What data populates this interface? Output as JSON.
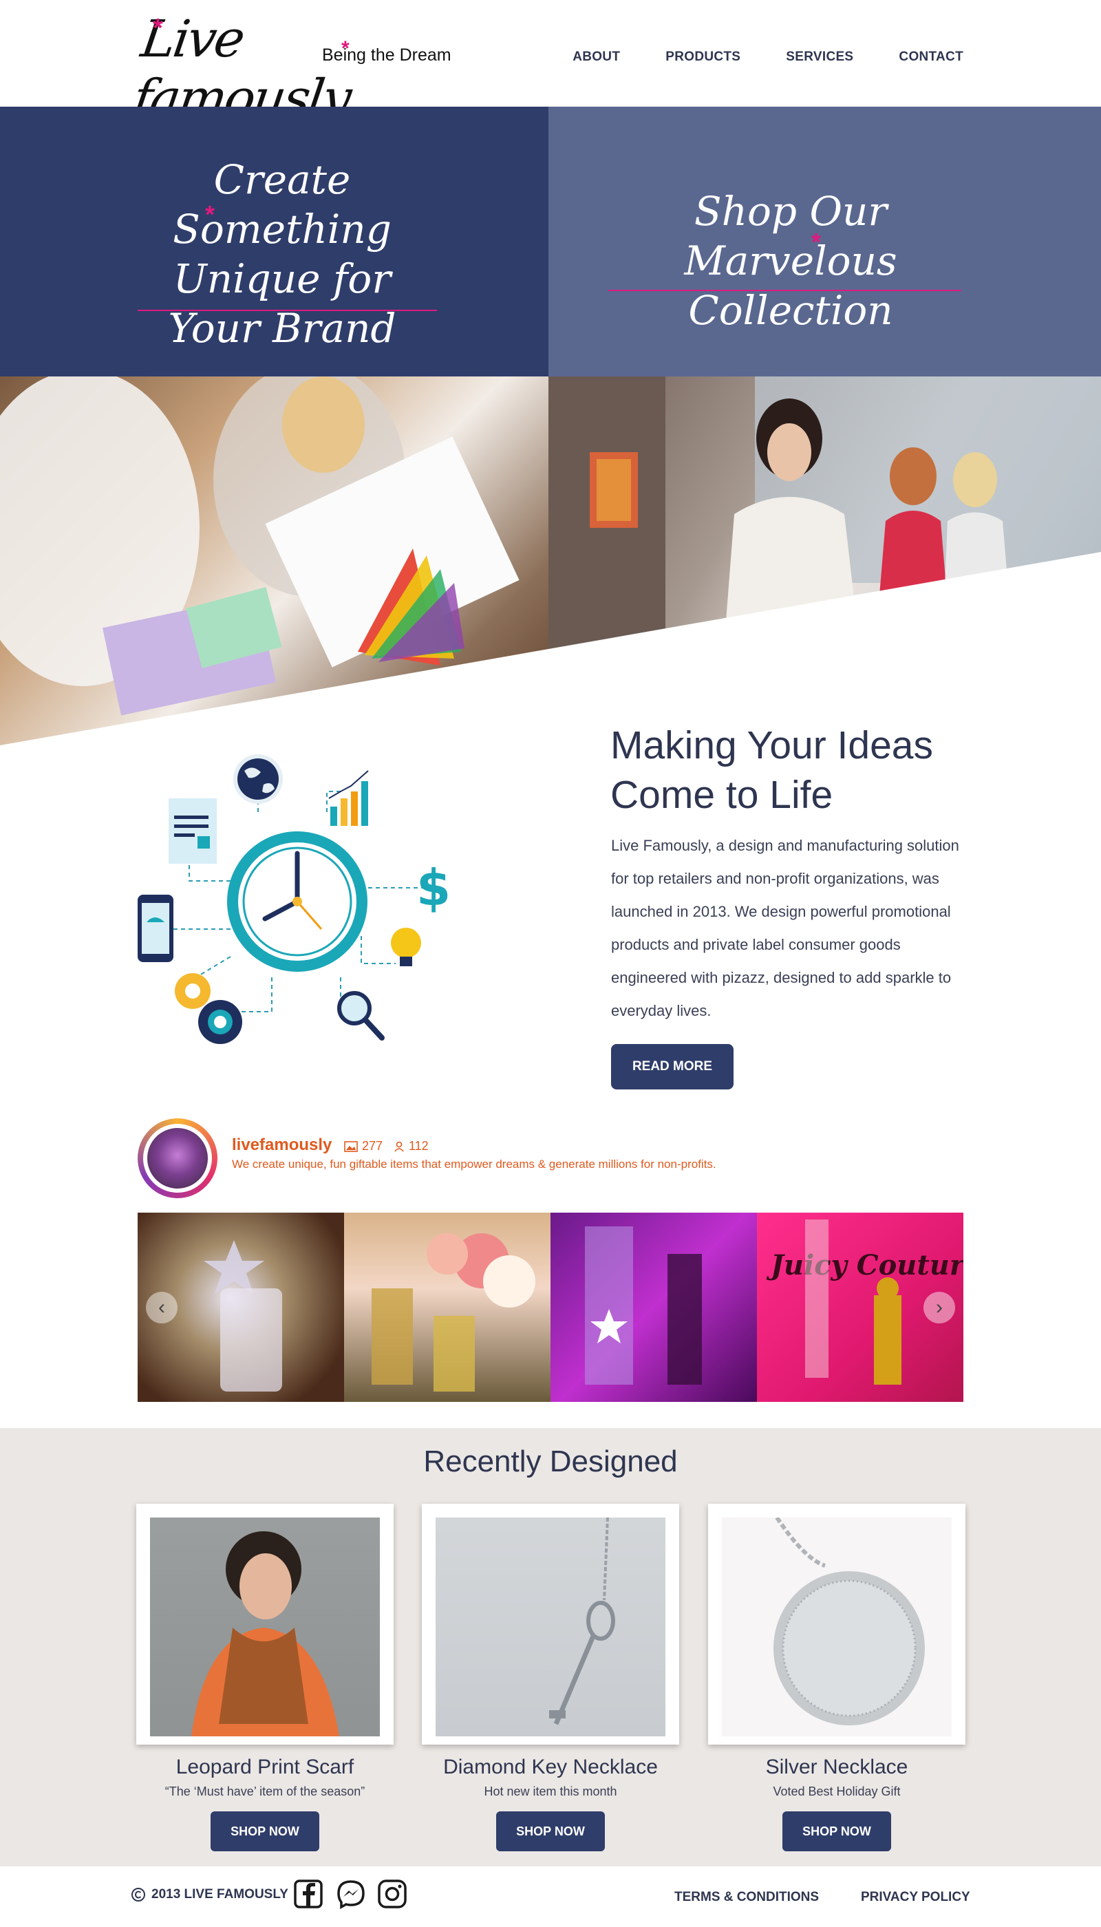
{
  "header": {
    "logo_text": "Live famously",
    "tagline": "Being the Dream",
    "nav": [
      {
        "label": "ABOUT"
      },
      {
        "label": "PRODUCTS"
      },
      {
        "label": "SERVICES"
      },
      {
        "label": "CONTACT"
      }
    ]
  },
  "banners": {
    "left_title": "Create Something Unique for Your Brand",
    "right_title": "Shop Our Marvelous Collection"
  },
  "about": {
    "title": "Making Your Ideas Come to Life",
    "text": "Live Famously, a design and manufacturing solution for top retailers and non-profit organizations, was launched in 2013. We design powerful promotional products and private label consumer goods engineered with pizazz, designed to add sparkle to everyday lives.",
    "button": "READ MORE"
  },
  "instagram": {
    "username": "livefamously",
    "posts": "277",
    "followers": "112",
    "bio": "We create unique, fun giftable items that empower dreams & generate millions for non-profits.",
    "prev": "‹",
    "next": "›",
    "tile_text": "Juicy Couture"
  },
  "recent": {
    "title": "Recently Designed",
    "items": [
      {
        "name": "Leopard Print Scarf",
        "sub": "“The ‘Must have’ item of the season”",
        "button": "SHOP NOW"
      },
      {
        "name": "Diamond Key Necklace",
        "sub": "Hot new item this month",
        "button": "SHOP NOW"
      },
      {
        "name": "Silver Necklace",
        "sub": "Voted Best Holiday Gift",
        "button": "SHOP NOW"
      }
    ]
  },
  "footer": {
    "copyright": "2013 LIVE FAMOUSLY",
    "terms": "TERMS & CONDITIONS",
    "privacy": "PRIVACY POLICY"
  },
  "colors": {
    "navy": "#2f3d6a",
    "slate": "#5a6890",
    "accent_pink": "#e0197d",
    "instagram_orange": "#e05a1f",
    "section_bg": "#ebe7e4"
  },
  "icons": [
    "copyright-icon",
    "facebook-icon",
    "messenger-icon",
    "instagram-icon",
    "image-icon",
    "user-icon",
    "clock-icon",
    "globe-icon",
    "bar-chart-icon",
    "dollar-icon",
    "lightbulb-icon",
    "magnifier-icon",
    "gear-icon",
    "phone-icon",
    "document-icon"
  ]
}
